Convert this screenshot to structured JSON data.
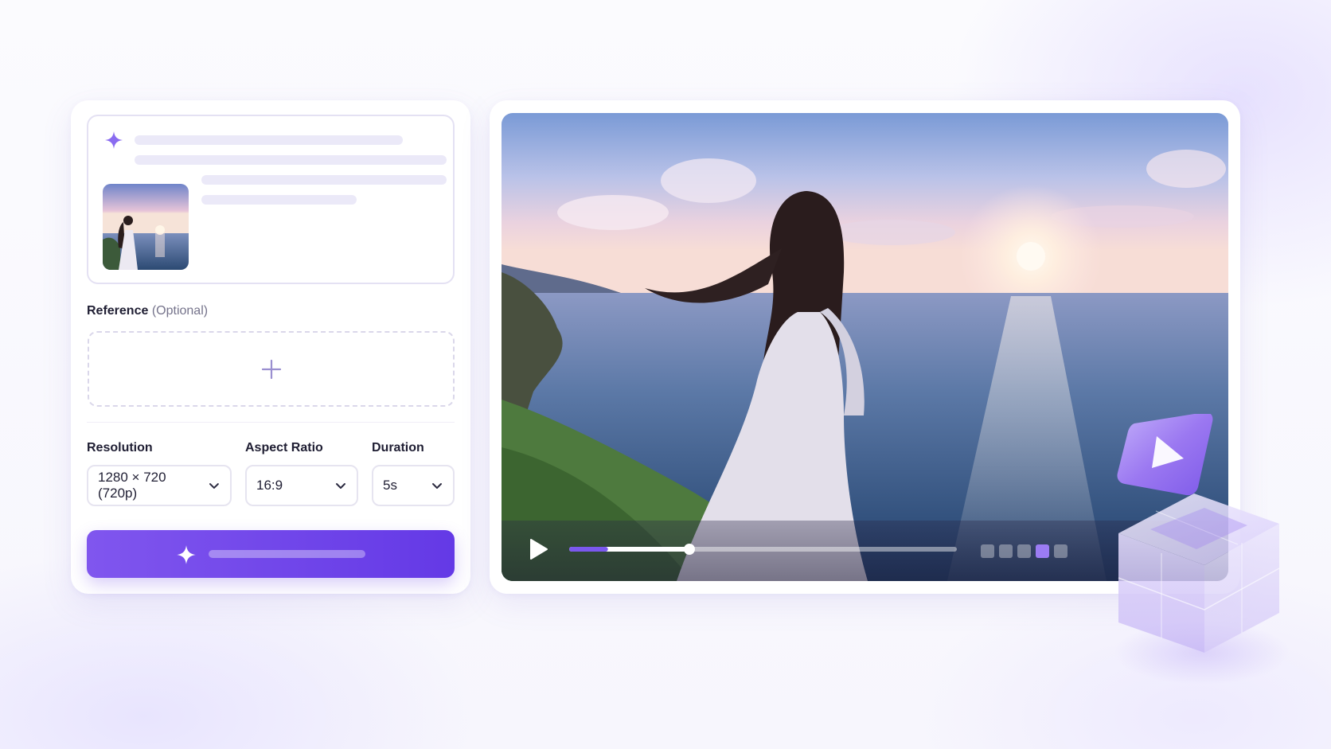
{
  "form": {
    "reference_label": "Reference",
    "reference_optional": "(Optional)",
    "resolution": {
      "label": "Resolution",
      "value": "1280 × 720 (720p)"
    },
    "aspect_ratio": {
      "label": "Aspect Ratio",
      "value": "16:9"
    },
    "duration": {
      "label": "Duration",
      "value": "5s"
    }
  },
  "icons": {
    "prompt": "sparkle-icon",
    "upload": "plus-icon",
    "generate": "sparkle-icon",
    "dropdown": "chevron-down-icon",
    "play": "play-icon"
  },
  "player": {
    "progress_buffered": 0.31,
    "progress_played": 0.1,
    "quality_steps": 5,
    "quality_selected": 4
  },
  "colors": {
    "accent": "#6a3ee8",
    "accent_light": "#9b7cf3",
    "placeholder": "#ebe9f8"
  }
}
